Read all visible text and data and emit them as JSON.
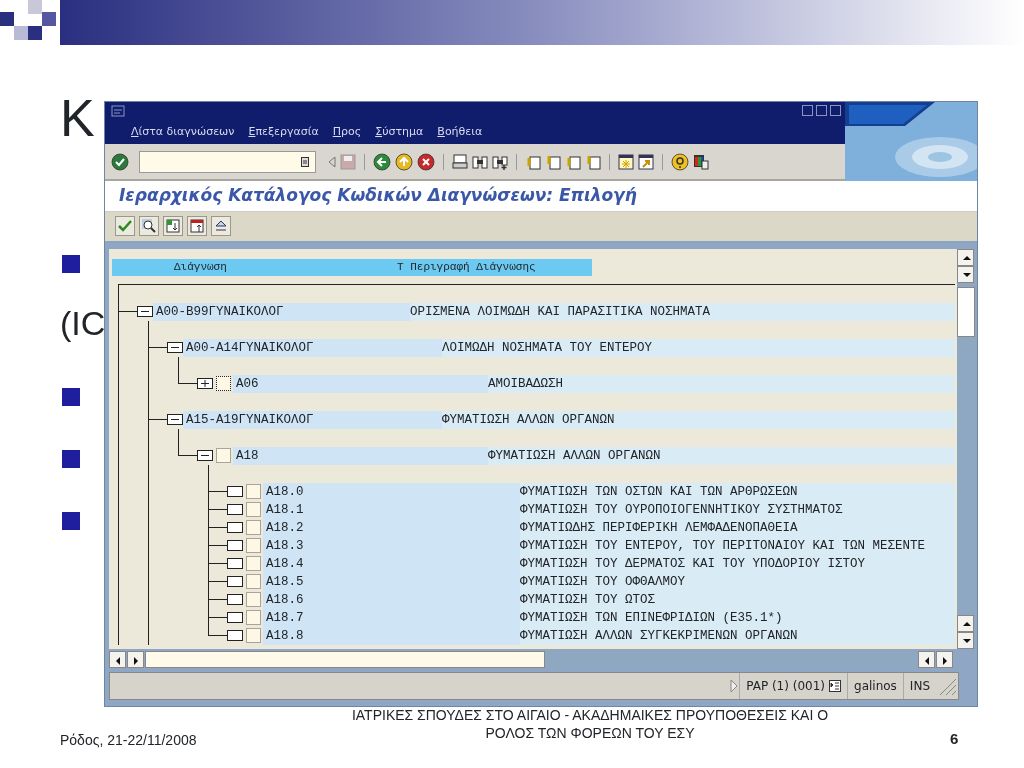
{
  "slide": {
    "title_fragment": "Κ",
    "text_fragment": "(IC"
  },
  "sap_window": {
    "menu": [
      "Λίστα διαγνώσεων",
      "Επεξεργασία",
      "Προς",
      "Σύστημα",
      "Βοήθεια"
    ],
    "title": "Ιεραρχικός Κατάλογος Κωδικών Διαγνώσεων: Επιλογή",
    "tree": {
      "columns": [
        "Διάγνωση",
        "Τ Περιγραφή Διάγνωσης"
      ],
      "nodes": [
        {
          "code": "A00-B99ΓΥΝΑΙΚΟΛΟΓ",
          "description": "ΟΡΙΣΜΕΝΑ ΛΟΙΜΩΔΗ ΚΑΙ ΠΑΡΑΣΙΤΙΚΑ ΝΟΣΗΜΑΤΑ",
          "kind": "node",
          "expanded": true,
          "children": [
            {
              "code": "A00-A14ΓΥΝΑΙΚΟΛΟΓ",
              "description": "ΛΟΙΜΩΔΗ ΝΟΣΗΜΑΤΑ ΤΟΥ ΕΝΤΕΡΟΥ",
              "kind": "node",
              "expanded": true,
              "children": [
                {
                  "code": "A06",
                  "description": "ΑΜΟΙΒΑΔΩΣΗ",
                  "kind": "node",
                  "expanded": false,
                  "checked": false,
                  "focused": true
                }
              ]
            },
            {
              "code": "A15-A19ΓΥΝΑΙΚΟΛΟΓ",
              "description": "ΦΥΜΑΤΙΩΣΗ ΑΛΛΩΝ ΟΡΓΑΝΩΝ",
              "kind": "node",
              "expanded": true,
              "children": [
                {
                  "code": "A18",
                  "description": "ΦΥΜΑΤΙΩΣΗ ΑΛΛΩΝ ΟΡΓΑΝΩΝ",
                  "kind": "node",
                  "expanded": true,
                  "checked": false,
                  "focused": false,
                  "children": [
                    {
                      "code": "A18.0",
                      "description": "ΦΥΜΑΤΙΩΣΗ ΤΩΝ ΟΣΤΩΝ ΚΑΙ ΤΩΝ ΑΡΘΡΩΣΕΩΝ",
                      "kind": "leaf",
                      "checked": false,
                      "focused": false
                    },
                    {
                      "code": "A18.1",
                      "description": "ΦΥΜΑΤΙΩΣΗ ΤΟΥ ΟΥΡΟΠΟΙΟΓΕΝΝΗΤΙΚΟΥ ΣΥΣΤΗΜΑΤΟΣ",
                      "kind": "leaf",
                      "checked": false,
                      "focused": false
                    },
                    {
                      "code": "A18.2",
                      "description": "ΦΥΜΑΤΙΩΔΗΣ ΠΕΡΙΦΕΡΙΚΗ ΛΕΜΦΑΔΕΝΟΠΑΘΕΙΑ",
                      "kind": "leaf",
                      "checked": false,
                      "focused": false
                    },
                    {
                      "code": "A18.3",
                      "description": "ΦΥΜΑΤΙΩΣΗ ΤΟΥ ΕΝΤΕΡΟΥ, ΤΟΥ ΠΕΡΙΤΟΝΑΙΟΥ ΚΑΙ ΤΩΝ ΜΕΣΕΝΤΕ",
                      "kind": "leaf",
                      "checked": false,
                      "focused": false
                    },
                    {
                      "code": "A18.4",
                      "description": "ΦΥΜΑΤΙΩΣΗ ΤΟΥ ΔΕΡΜΑΤΟΣ ΚΑΙ ΤΟΥ ΥΠΟΔΟΡΙΟΥ ΙΣΤΟΥ",
                      "kind": "leaf",
                      "checked": false,
                      "focused": false
                    },
                    {
                      "code": "A18.5",
                      "description": "ΦΥΜΑΤΙΩΣΗ ΤΟΥ ΟΦΘΑΛΜΟΥ",
                      "kind": "leaf",
                      "checked": false,
                      "focused": false
                    },
                    {
                      "code": "A18.6",
                      "description": "ΦΥΜΑΤΙΩΣΗ ΤΟΥ ΩΤΟΣ",
                      "kind": "leaf",
                      "checked": false,
                      "focused": false
                    },
                    {
                      "code": "A18.7",
                      "description": "ΦΥΜΑΤΙΩΣΗ ΤΩΝ ΕΠΙΝΕΦΡΙΔΙΩΝ (E35.1*)",
                      "kind": "leaf",
                      "checked": false,
                      "focused": false
                    },
                    {
                      "code": "A18.8",
                      "description": "ΦΥΜΑΤΙΩΣΗ ΑΛΛΩΝ ΣΥΓΚΕΚΡΙΜΕΝΩΝ ΟΡΓΑΝΩΝ",
                      "kind": "leaf",
                      "checked": false,
                      "focused": false
                    }
                  ]
                }
              ]
            }
          ]
        }
      ]
    },
    "status_bar": {
      "system": "PAP (1) (001)",
      "user": "galinos",
      "mode": "INS"
    }
  },
  "footer": {
    "place_date": "Ρόδος, 21-22/11/2008",
    "caption": [
      "ΙΑΤΡΙΚΕΣ ΣΠΟΥΔΕΣ ΣΤΟ ΑΙΓΑΙΟ - ΑΚΑΔΗΜΑΙΚΕΣ ΠΡΟΥΠΟΘΕΣΕΙΣ ΚΑΙ Ο",
      "ΡΟΛΟΣ ΤΩΝ ΦΟΡΕΩΝ ΤΟΥ ΕΣΥ"
    ],
    "page_number": "6"
  }
}
